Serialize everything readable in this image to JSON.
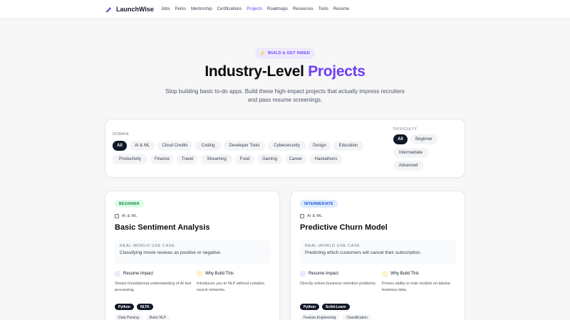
{
  "nav": {
    "brand": "LaunchWise",
    "links": [
      "Jobs",
      "Perks",
      "Mentorship",
      "Certifications",
      "Projects",
      "Roadmaps",
      "Resources",
      "Tools",
      "Resume"
    ],
    "active": "Projects"
  },
  "hero": {
    "badge": "BUILD & GET HIRED",
    "title_plain": "Industry-Level ",
    "title_accent": "Projects",
    "subtitle": "Stop building basic to-do apps. Build these high-impact projects that actually impress recruiters and pass resume screenings."
  },
  "filters": {
    "domain_label": "DOMAIN",
    "domains": [
      "All",
      "AI & ML",
      "Cloud Credits",
      "Coding",
      "Developer Tools",
      "Cybersecurity",
      "Design",
      "Education",
      "Productivity",
      "Finance",
      "Travel",
      "Streaming",
      "Food",
      "Gaming",
      "Career",
      "Hackathons"
    ],
    "difficulty_label": "DIFFICULTY",
    "difficulties": [
      "All",
      "Beginner",
      "Intermediate",
      "Advanced"
    ]
  },
  "cards": [
    {
      "level": "BEGINNER",
      "category": "AI & ML",
      "title": "Basic Sentiment Analysis",
      "usecase_label": "REAL-WORLD USE CASE",
      "usecase": "Classifying movie reviews as positive or negative.",
      "impact_label": "Resume Impact",
      "impact": "Shows foundational understanding of AI text processing.",
      "why_label": "Why Build This",
      "why": "Introduces you to NLP without complex neural networks.",
      "tech": [
        "Python",
        "NLTK"
      ],
      "skills": [
        "Data Parsing",
        "Basic NLP"
      ]
    },
    {
      "level": "INTERMEDIATE",
      "category": "AI & ML",
      "title": "Predictive Churn Model",
      "usecase_label": "REAL-WORLD USE CASE",
      "usecase": "Predicting which customers will cancel their subscription.",
      "impact_label": "Resume Impact",
      "impact": "Directly solves business retention problems.",
      "why_label": "Why Build This",
      "why": "Proves ability to train models on tabular business data.",
      "tech": [
        "Python",
        "Scikit-Learn"
      ],
      "skills": [
        "Feature Engineering",
        "Classification"
      ]
    }
  ],
  "colors": {
    "accent": "#6d3df5",
    "beginner_bg": "#dcfce7",
    "intermediate_bg": "#dbeafe",
    "dark": "#111827"
  }
}
